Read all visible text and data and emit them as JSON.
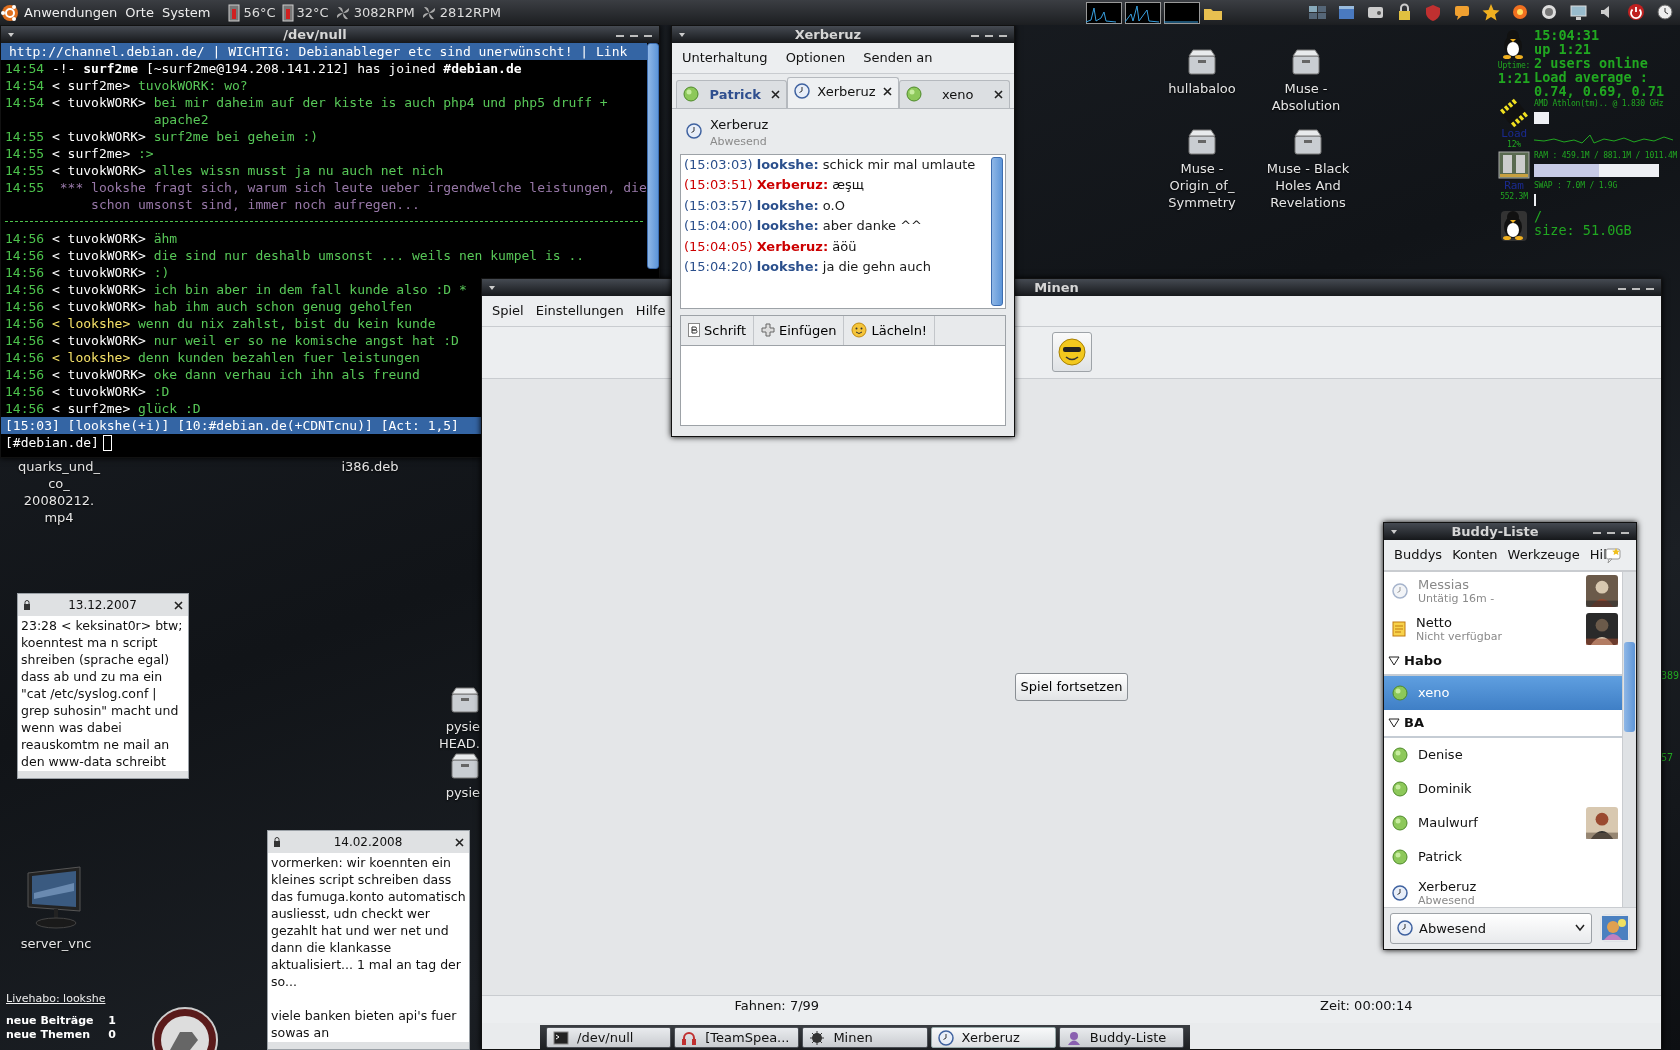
{
  "top_panel": {
    "menus": [
      {
        "label": "Anwendungen"
      },
      {
        "label": "Orte"
      },
      {
        "label": "System"
      }
    ],
    "sensors": [
      {
        "kind": "temperature",
        "reading": "56°C"
      },
      {
        "kind": "temperature",
        "reading": "32°C"
      },
      {
        "kind": "fan",
        "reading": "3082RPM"
      },
      {
        "kind": "fan",
        "reading": "2812RPM"
      }
    ]
  },
  "desktop_icons": [
    {
      "label": "hullabaloo",
      "kind": "archive"
    },
    {
      "label": "Muse - Absolution",
      "kind": "archive"
    },
    {
      "label": "Muse - Origin_of_ Symmetry",
      "kind": "archive"
    },
    {
      "label": "Muse - Black Holes And Revelations",
      "kind": "archive"
    },
    {
      "label": "quarks_und_ co_ 20080212. mp4",
      "kind": "label"
    },
    {
      "label": "i386.deb",
      "kind": "label"
    },
    {
      "label": "pysie HEAD.",
      "kind": "archive"
    },
    {
      "label": "pysie",
      "kind": "archive"
    },
    {
      "label": "server_vnc",
      "kind": "monitor"
    }
  ],
  "conky": {
    "clock": "15:04:31",
    "uptime": "up 1:21",
    "users": "2 users online",
    "load_label": "Load average :",
    "load_values": "0.74, 0.69, 0.71",
    "uptime_label": "Uptime:",
    "uptime_value": "1:21",
    "cpu": {
      "name": "AMD Athlon(tm).. @ 1.830 GHz",
      "label": "Load",
      "percent": "12%"
    },
    "ram": {
      "text": "RAM : 459.1M / 881.1M / 1011.4M",
      "level": 0.52,
      "swap_text": "SWAP : 7.0M / 1.9G",
      "label": "Ram",
      "value": "552.3M"
    },
    "disk": {
      "mount": "/",
      "size": "size: 51.0GB"
    },
    "fragments": [
      "389",
      "57"
    ]
  },
  "terminal": {
    "title": "/dev/null",
    "topic": "http://channel.debian.de/ | WICHTIG: Debianableger etc sind unerwünscht! | Link",
    "lines": [
      {
        "kind": "join",
        "time": "14:54",
        "text": "-!- **surf2me** [~surf2me@194.208.141.212] has joined **#debian.de**"
      },
      {
        "kind": "message",
        "time": "14:54",
        "nick": "< surf2me>",
        "highlight": false,
        "text": "tuvokWORK: wo?"
      },
      {
        "kind": "message",
        "time": "14:54",
        "nick": "< tuvokWORK>",
        "highlight": false,
        "text": "bei mir daheim auf der kiste is auch php4 und php5 druff + apache2"
      },
      {
        "kind": "message",
        "time": "14:55",
        "nick": "< tuvokWORK>",
        "highlight": false,
        "text": "surf2me bei geheim :)"
      },
      {
        "kind": "message",
        "time": "14:55",
        "nick": "< surf2me>",
        "highlight": false,
        "text": ":>"
      },
      {
        "kind": "message",
        "time": "14:55",
        "nick": "< tuvokWORK>",
        "highlight": false,
        "text": "alles wissn musst ja nu auch net nich"
      },
      {
        "kind": "action",
        "time": "14:55",
        "marker": "***",
        "text": "lookshe fragt sich, warum sich leute ueber irgendwelche leistungen, die schon umsonst sind, immer noch aufregen..."
      },
      {
        "kind": "separator"
      },
      {
        "kind": "message",
        "time": "14:56",
        "nick": "< tuvokWORK>",
        "highlight": false,
        "text": "ähm"
      },
      {
        "kind": "message",
        "time": "14:56",
        "nick": "< tuvokWORK>",
        "highlight": false,
        "text": "die sind nur deshalb umsonst ... weils nen kumpel is .."
      },
      {
        "kind": "message",
        "time": "14:56",
        "nick": "< tuvokWORK>",
        "highlight": false,
        "text": ":)"
      },
      {
        "kind": "message",
        "time": "14:56",
        "nick": "< tuvokWORK>",
        "highlight": false,
        "text": "ich bin aber in dem fall kunde also :D *"
      },
      {
        "kind": "message",
        "time": "14:56",
        "nick": "< tuvokWORK>",
        "highlight": false,
        "text": "hab ihm auch schon genug geholfen"
      },
      {
        "kind": "message",
        "time": "14:56",
        "nick": "< lookshe>",
        "highlight": true,
        "text": "wenn du nix zahlst, bist du kein kunde"
      },
      {
        "kind": "message",
        "time": "14:56",
        "nick": "< tuvokWORK>",
        "highlight": false,
        "text": "nur weil er so ne komische angst hat :D"
      },
      {
        "kind": "message",
        "time": "14:56",
        "nick": "< lookshe>",
        "highlight": true,
        "text": "denn kunden bezahlen fuer leistungen"
      },
      {
        "kind": "message",
        "time": "14:56",
        "nick": "< tuvokWORK>",
        "highlight": false,
        "text": "oke dann verhau ich ihn als freund"
      },
      {
        "kind": "message",
        "time": "14:56",
        "nick": "< tuvokWORK>",
        "highlight": false,
        "text": ":D"
      },
      {
        "kind": "message",
        "time": "14:56",
        "nick": "< surf2me>",
        "highlight": false,
        "text": "glück :D"
      }
    ],
    "status": "[15:03] [lookshe(+i)] [10:#debian.de(+CDNTcnu)] [Act: 1,5]",
    "prompt": "[#debian.de]"
  },
  "minesweeper": {
    "title": "Minen",
    "menus": [
      "Spiel",
      "Einstellungen",
      "Hilfe"
    ],
    "resume_button": "Spiel fortsetzen",
    "flags": "Fahnen: 7/99",
    "time": "Zeit: 00:00:14"
  },
  "chat_window": {
    "title": "Xerberuz",
    "menus": [
      "Unterhaltung",
      "Optionen",
      "Senden an"
    ],
    "tabs": [
      {
        "label": "Patrick",
        "kind": "available",
        "selected": false,
        "unread": true
      },
      {
        "label": "Xerberuz",
        "kind": "away",
        "selected": true,
        "unread": false
      },
      {
        "label": "xeno",
        "kind": "available",
        "selected": false,
        "unread": false
      }
    ],
    "header": {
      "name": "Xerberuz",
      "kind": "away",
      "status_text": "Abwesend"
    },
    "messages": [
      {
        "kind": "outgoing",
        "time": "(15:03:03)",
        "sender": "lookshe:",
        "text": "schick mir mal umlaute"
      },
      {
        "kind": "incoming",
        "time": "(15:03:51)",
        "sender": "Xerberuz:",
        "text": "æşщ"
      },
      {
        "kind": "outgoing",
        "time": "(15:03:57)",
        "sender": "lookshe:",
        "text": "o.O"
      },
      {
        "kind": "outgoing",
        "time": "(15:04:00)",
        "sender": "lookshe:",
        "text": "aber danke ^^"
      },
      {
        "kind": "incoming",
        "time": "(15:04:05)",
        "sender": "Xerberuz:",
        "text": "äöü"
      },
      {
        "kind": "outgoing",
        "time": "(15:04:20)",
        "sender": "lookshe:",
        "text": "ja die gehn auch"
      }
    ],
    "toolbar": [
      {
        "kind": "font",
        "label": "Schrift"
      },
      {
        "kind": "insert",
        "label": "Einfügen"
      },
      {
        "kind": "smiley",
        "label": "Lächeln!"
      }
    ]
  },
  "buddy_list": {
    "title": "Buddy-Liste",
    "menus": [
      "Buddys",
      "Konten",
      "Werkzeuge",
      "Hil"
    ],
    "entries": [
      {
        "kind": "idle",
        "name": "Messias",
        "status_text": "Untätig 16m -",
        "avatar": true,
        "selected": false
      },
      {
        "kind": "unavailable",
        "name": "Netto",
        "status_text": "Nicht verfügbar",
        "avatar": true,
        "selected": false
      },
      {
        "kind": "group",
        "name": "Habo",
        "expanded": true
      },
      {
        "kind": "available",
        "name": "xeno",
        "avatar": false,
        "selected": true
      },
      {
        "kind": "group",
        "name": "BA",
        "expanded": true
      },
      {
        "kind": "available",
        "name": "Denise",
        "avatar": false,
        "selected": false
      },
      {
        "kind": "available",
        "name": "Dominik",
        "avatar": false,
        "selected": false
      },
      {
        "kind": "available",
        "name": "Maulwurf",
        "avatar": true,
        "selected": false
      },
      {
        "kind": "available",
        "name": "Patrick",
        "avatar": false,
        "selected": false
      },
      {
        "kind": "away",
        "name": "Xerberuz",
        "status_text": "Abwesend",
        "avatar": false,
        "selected": false
      }
    ],
    "status_select": {
      "value": "Abwesend",
      "kind": "away"
    }
  },
  "notes": [
    {
      "date": "13.12.2007",
      "text": "23:28 < keksinat0r> btw; koenntest ma n script shreiben (sprache egal) dass ab und zu ma ein \"cat /etc/syslog.conf | grep suhosin\" macht und wenn was dabei reauskomtm ne mail an den www-data schreibt"
    },
    {
      "date": "14.02.2008",
      "text": "vormerken: wir koennten ein kleines script schreiben dass das fumuga.konto automatisch ausliesst, udn checkt wer gezahlt hat und wer net und dann die klankasse aktualisiert... 1 mal an tag der so...\n\nviele banken bieten api's fuer sowas an"
    }
  ],
  "forum_widget": {
    "link": "Livehabo: lookshe",
    "rows": [
      {
        "label": "neue Beiträge",
        "count": "1"
      },
      {
        "label": "neue Themen",
        "count": "0"
      }
    ]
  },
  "taskbar": [
    {
      "kind": "terminal",
      "label": "/dev/null",
      "selected": false
    },
    {
      "kind": "teamspeak",
      "label": "[TeamSpea...",
      "selected": false
    },
    {
      "kind": "mines",
      "label": "Minen",
      "selected": false
    },
    {
      "kind": "away",
      "label": "Xerberuz",
      "selected": true
    },
    {
      "kind": "buddies",
      "label": "Buddy-Liste",
      "selected": false
    }
  ]
}
